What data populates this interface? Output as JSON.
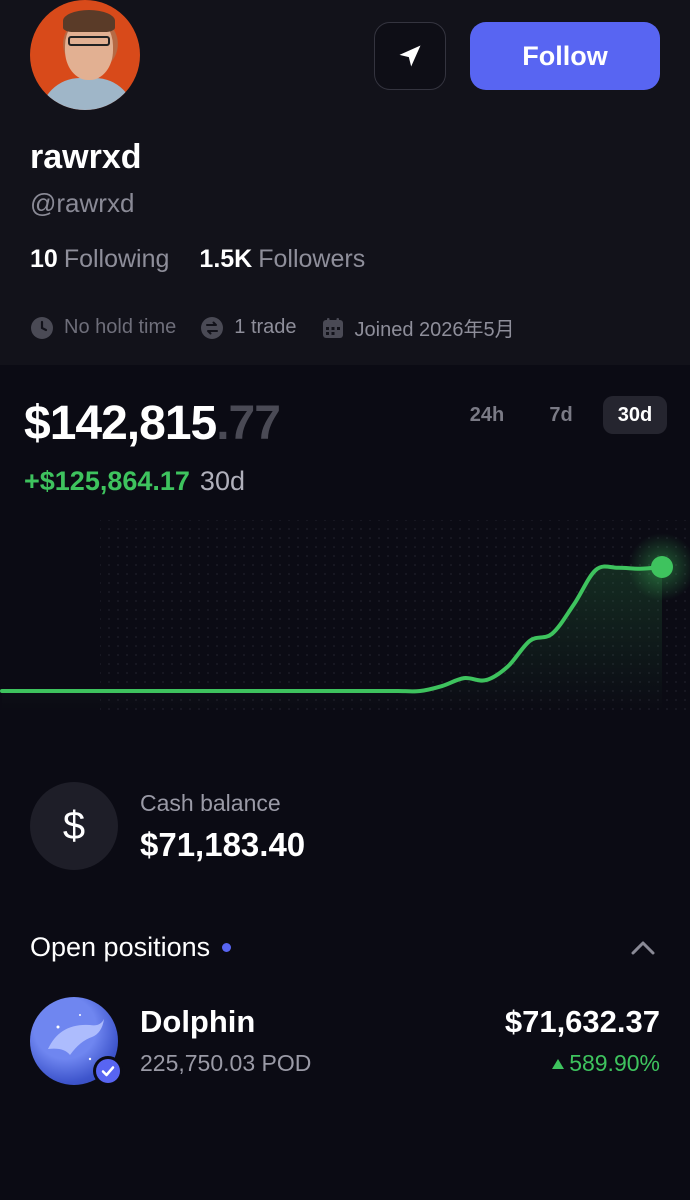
{
  "profile": {
    "display_name": "rawrxd",
    "handle": "@rawrxd",
    "following_count": "10",
    "following_label": "Following",
    "followers_count": "1.5K",
    "followers_label": "Followers",
    "follow_label": "Follow",
    "meta": {
      "hold_time": "No hold time",
      "trades": "1 trade",
      "joined": "Joined 2026年5月"
    }
  },
  "portfolio": {
    "balance_main": "$142,815",
    "balance_cents": ".77",
    "change_amount": "+$125,864.17",
    "change_period": "30d",
    "ranges": [
      "24h",
      "7d",
      "30d"
    ],
    "active_range": "30d"
  },
  "chart_data": {
    "type": "line",
    "x": [
      0,
      1,
      2,
      3,
      4,
      5,
      6,
      7,
      8,
      9,
      10,
      11,
      12,
      13,
      14,
      15,
      16,
      17,
      18,
      19,
      20,
      21,
      22,
      23,
      24,
      25,
      26,
      27,
      28,
      29,
      30
    ],
    "values": [
      16951.6,
      16951.6,
      16951.6,
      16951.6,
      16951.6,
      16951.6,
      16951.6,
      16951.6,
      16951.6,
      16951.6,
      16951.6,
      16951.6,
      16951.6,
      16951.6,
      16951.6,
      16951.6,
      16951.6,
      16951.6,
      16951.6,
      16951.6,
      22000,
      30000,
      28000,
      42000,
      68000,
      75000,
      105000,
      140000,
      142000,
      141000,
      142815.77
    ],
    "color": "#3ec35e"
  },
  "cash": {
    "label": "Cash balance",
    "value": "$71,183.40"
  },
  "positions": {
    "title": "Open positions",
    "items": [
      {
        "name": "Dolphin",
        "amount": "225,750.03 POD",
        "value": "$71,632.37",
        "change": "589.90%"
      }
    ]
  },
  "colors": {
    "accent": "#5865f2",
    "positive": "#3ec35e",
    "background": "#0b0b14"
  },
  "icons": {
    "send": "paper-plane-icon",
    "clock": "clock-icon",
    "trade": "swap-icon",
    "calendar": "calendar-icon",
    "collapse": "chevron-up-icon",
    "verified": "verified-badge-icon"
  }
}
